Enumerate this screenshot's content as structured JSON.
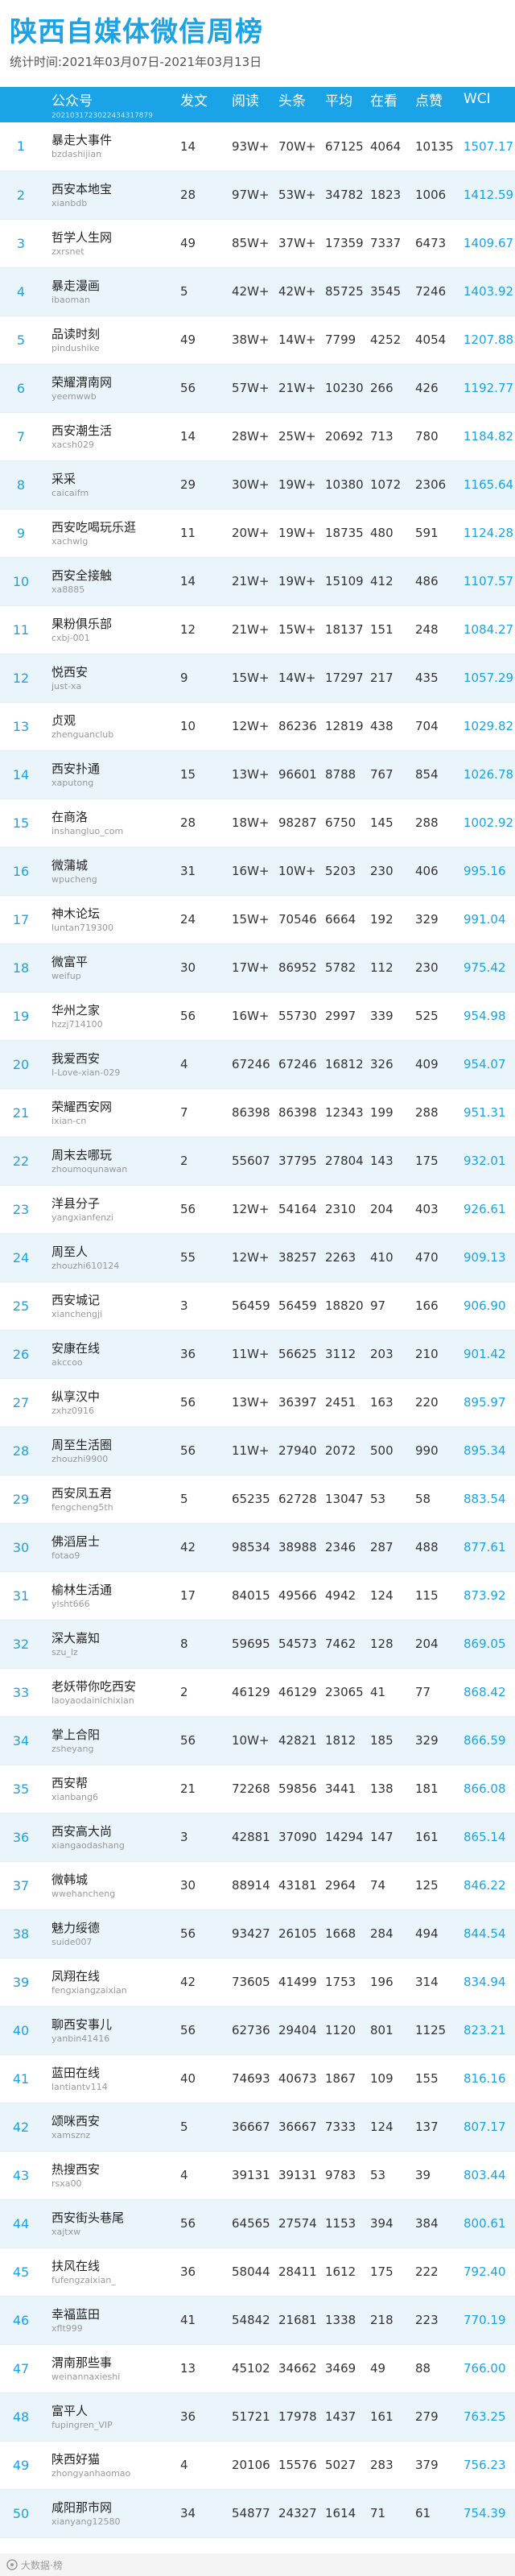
{
  "header": {
    "title": "陕西自媒体微信周榜",
    "period": "统计时间:2021年03月07日-2021年03月13日"
  },
  "columns": {
    "account": "公众号",
    "posts": "发文",
    "reads": "阅读",
    "headline": "头条",
    "average": "平均",
    "watching": "在看",
    "likes": "点赞",
    "wci": "WCI",
    "sub_code": "20210317230224343178​79"
  },
  "rows": [
    {
      "rank": "1",
      "name": "暴走大事件",
      "id": "bzdashijian",
      "posts": "14",
      "reads": "93W+",
      "head": "70W+",
      "avg": "67125",
      "see": "4064",
      "like": "10135",
      "wci": "1507.17"
    },
    {
      "rank": "2",
      "name": "西安本地宝",
      "id": "xianbdb",
      "posts": "28",
      "reads": "97W+",
      "head": "53W+",
      "avg": "34782",
      "see": "1823",
      "like": "1006",
      "wci": "1412.59"
    },
    {
      "rank": "3",
      "name": "哲学人生网",
      "id": "zxrsnet",
      "posts": "49",
      "reads": "85W+",
      "head": "37W+",
      "avg": "17359",
      "see": "7337",
      "like": "6473",
      "wci": "1409.67"
    },
    {
      "rank": "4",
      "name": "暴走漫画",
      "id": "ibaoman",
      "posts": "5",
      "reads": "42W+",
      "head": "42W+",
      "avg": "85725",
      "see": "3545",
      "like": "7246",
      "wci": "1403.92"
    },
    {
      "rank": "5",
      "name": "品读时刻",
      "id": "pindushike",
      "posts": "49",
      "reads": "38W+",
      "head": "14W+",
      "avg": "7799",
      "see": "4252",
      "like": "4054",
      "wci": "1207.88"
    },
    {
      "rank": "6",
      "name": "荣耀渭南网",
      "id": "yeemwwb",
      "posts": "56",
      "reads": "57W+",
      "head": "21W+",
      "avg": "10230",
      "see": "266",
      "like": "426",
      "wci": "1192.77"
    },
    {
      "rank": "7",
      "name": "西安潮生活",
      "id": "xacsh029",
      "posts": "14",
      "reads": "28W+",
      "head": "25W+",
      "avg": "20692",
      "see": "713",
      "like": "780",
      "wci": "1184.82"
    },
    {
      "rank": "8",
      "name": "采采",
      "id": "caicaifm",
      "posts": "29",
      "reads": "30W+",
      "head": "19W+",
      "avg": "10380",
      "see": "1072",
      "like": "2306",
      "wci": "1165.64"
    },
    {
      "rank": "9",
      "name": "西安吃喝玩乐逛",
      "id": "xachwlg",
      "posts": "11",
      "reads": "20W+",
      "head": "19W+",
      "avg": "18735",
      "see": "480",
      "like": "591",
      "wci": "1124.28"
    },
    {
      "rank": "10",
      "name": "西安全接触",
      "id": "xa8885",
      "posts": "14",
      "reads": "21W+",
      "head": "19W+",
      "avg": "15109",
      "see": "412",
      "like": "486",
      "wci": "1107.57"
    },
    {
      "rank": "11",
      "name": "果粉俱乐部",
      "id": "cxbj-001",
      "posts": "12",
      "reads": "21W+",
      "head": "15W+",
      "avg": "18137",
      "see": "151",
      "like": "248",
      "wci": "1084.27"
    },
    {
      "rank": "12",
      "name": "悦西安",
      "id": "just-xa",
      "posts": "9",
      "reads": "15W+",
      "head": "14W+",
      "avg": "17297",
      "see": "217",
      "like": "435",
      "wci": "1057.29"
    },
    {
      "rank": "13",
      "name": "贞观",
      "id": "zhenguanclub",
      "posts": "10",
      "reads": "12W+",
      "head": "86236",
      "avg": "12819",
      "see": "438",
      "like": "704",
      "wci": "1029.82"
    },
    {
      "rank": "14",
      "name": "西安扑通",
      "id": "xaputong",
      "posts": "15",
      "reads": "13W+",
      "head": "96601",
      "avg": "8788",
      "see": "767",
      "like": "854",
      "wci": "1026.78"
    },
    {
      "rank": "15",
      "name": "在商洛",
      "id": "inshangluo_com",
      "posts": "28",
      "reads": "18W+",
      "head": "98287",
      "avg": "6750",
      "see": "145",
      "like": "288",
      "wci": "1002.92"
    },
    {
      "rank": "16",
      "name": "微蒲城",
      "id": "wpucheng",
      "posts": "31",
      "reads": "16W+",
      "head": "10W+",
      "avg": "5203",
      "see": "230",
      "like": "406",
      "wci": "995.16"
    },
    {
      "rank": "17",
      "name": "神木论坛",
      "id": "luntan719300",
      "posts": "24",
      "reads": "15W+",
      "head": "70546",
      "avg": "6664",
      "see": "192",
      "like": "329",
      "wci": "991.04"
    },
    {
      "rank": "18",
      "name": "微富平",
      "id": "weifup",
      "posts": "30",
      "reads": "17W+",
      "head": "86952",
      "avg": "5782",
      "see": "112",
      "like": "230",
      "wci": "975.42"
    },
    {
      "rank": "19",
      "name": "华州之家",
      "id": "hzzj714100",
      "posts": "56",
      "reads": "16W+",
      "head": "55730",
      "avg": "2997",
      "see": "339",
      "like": "525",
      "wci": "954.98"
    },
    {
      "rank": "20",
      "name": "我爱西安",
      "id": "I-Love-xian-029",
      "posts": "4",
      "reads": "67246",
      "head": "67246",
      "avg": "16812",
      "see": "326",
      "like": "409",
      "wci": "954.07"
    },
    {
      "rank": "21",
      "name": "荣耀西安网",
      "id": "ixian-cn",
      "posts": "7",
      "reads": "86398",
      "head": "86398",
      "avg": "12343",
      "see": "199",
      "like": "288",
      "wci": "951.31"
    },
    {
      "rank": "22",
      "name": "周末去哪玩",
      "id": "zhoumoqunawan",
      "posts": "2",
      "reads": "55607",
      "head": "37795",
      "avg": "27804",
      "see": "143",
      "like": "175",
      "wci": "932.01"
    },
    {
      "rank": "23",
      "name": "洋县分子",
      "id": "yangxianfenzi",
      "posts": "56",
      "reads": "12W+",
      "head": "54164",
      "avg": "2310",
      "see": "204",
      "like": "403",
      "wci": "926.61"
    },
    {
      "rank": "24",
      "name": "周至人",
      "id": "zhouzhi610124",
      "posts": "55",
      "reads": "12W+",
      "head": "38257",
      "avg": "2263",
      "see": "410",
      "like": "470",
      "wci": "909.13"
    },
    {
      "rank": "25",
      "name": "西安城记",
      "id": "xianchengji",
      "posts": "3",
      "reads": "56459",
      "head": "56459",
      "avg": "18820",
      "see": "97",
      "like": "166",
      "wci": "906.90"
    },
    {
      "rank": "26",
      "name": "安康在线",
      "id": "akccoo",
      "posts": "36",
      "reads": "11W+",
      "head": "56625",
      "avg": "3112",
      "see": "203",
      "like": "210",
      "wci": "901.42"
    },
    {
      "rank": "27",
      "name": "纵享汉中",
      "id": "zxhz0916",
      "posts": "56",
      "reads": "13W+",
      "head": "36397",
      "avg": "2451",
      "see": "163",
      "like": "220",
      "wci": "895.97"
    },
    {
      "rank": "28",
      "name": "周至生活圈",
      "id": "zhouzhi9900",
      "posts": "56",
      "reads": "11W+",
      "head": "27940",
      "avg": "2072",
      "see": "500",
      "like": "990",
      "wci": "895.34"
    },
    {
      "rank": "29",
      "name": "西安凤五君",
      "id": "fengcheng5th",
      "posts": "5",
      "reads": "65235",
      "head": "62728",
      "avg": "13047",
      "see": "53",
      "like": "58",
      "wci": "883.54"
    },
    {
      "rank": "30",
      "name": "佛滔居士",
      "id": "fotao9",
      "posts": "42",
      "reads": "98534",
      "head": "38988",
      "avg": "2346",
      "see": "287",
      "like": "488",
      "wci": "877.61"
    },
    {
      "rank": "31",
      "name": "榆林生活通",
      "id": "ylsht666",
      "posts": "17",
      "reads": "84015",
      "head": "49566",
      "avg": "4942",
      "see": "124",
      "like": "115",
      "wci": "873.92"
    },
    {
      "rank": "32",
      "name": "深大嘉知",
      "id": "szu_lz",
      "posts": "8",
      "reads": "59695",
      "head": "54573",
      "avg": "7462",
      "see": "128",
      "like": "204",
      "wci": "869.05"
    },
    {
      "rank": "33",
      "name": "老妖带你吃西安",
      "id": "laoyaodainichixian",
      "posts": "2",
      "reads": "46129",
      "head": "46129",
      "avg": "23065",
      "see": "41",
      "like": "77",
      "wci": "868.42"
    },
    {
      "rank": "34",
      "name": "掌上合阳",
      "id": "zsheyang",
      "posts": "56",
      "reads": "10W+",
      "head": "42821",
      "avg": "1812",
      "see": "185",
      "like": "329",
      "wci": "866.59"
    },
    {
      "rank": "35",
      "name": "西安帮",
      "id": "xianbang6",
      "posts": "21",
      "reads": "72268",
      "head": "59856",
      "avg": "3441",
      "see": "138",
      "like": "181",
      "wci": "866.08"
    },
    {
      "rank": "36",
      "name": "西安高大尚",
      "id": "xiangaodashang",
      "posts": "3",
      "reads": "42881",
      "head": "37090",
      "avg": "14294",
      "see": "147",
      "like": "161",
      "wci": "865.14"
    },
    {
      "rank": "37",
      "name": "微韩城",
      "id": "wwehancheng",
      "posts": "30",
      "reads": "88914",
      "head": "43181",
      "avg": "2964",
      "see": "74",
      "like": "125",
      "wci": "846.22"
    },
    {
      "rank": "38",
      "name": "魅力绥德",
      "id": "suide007",
      "posts": "56",
      "reads": "93427",
      "head": "26105",
      "avg": "1668",
      "see": "284",
      "like": "494",
      "wci": "844.54"
    },
    {
      "rank": "39",
      "name": "凤翔在线",
      "id": "fengxiangzaixian",
      "posts": "42",
      "reads": "73605",
      "head": "41499",
      "avg": "1753",
      "see": "196",
      "like": "314",
      "wci": "834.94"
    },
    {
      "rank": "40",
      "name": "聊西安事儿",
      "id": "yanbin41416",
      "posts": "56",
      "reads": "62736",
      "head": "29404",
      "avg": "1120",
      "see": "801",
      "like": "1125",
      "wci": "823.21"
    },
    {
      "rank": "41",
      "name": "蓝田在线",
      "id": "lantiantv114",
      "posts": "40",
      "reads": "74693",
      "head": "40673",
      "avg": "1867",
      "see": "109",
      "like": "155",
      "wci": "816.16"
    },
    {
      "rank": "42",
      "name": "颂咪西安",
      "id": "xamsznz",
      "posts": "5",
      "reads": "36667",
      "head": "36667",
      "avg": "7333",
      "see": "124",
      "like": "137",
      "wci": "807.17"
    },
    {
      "rank": "43",
      "name": "热搜西安",
      "id": "rsxa00",
      "posts": "4",
      "reads": "39131",
      "head": "39131",
      "avg": "9783",
      "see": "53",
      "like": "39",
      "wci": "803.44"
    },
    {
      "rank": "44",
      "name": "西安街头巷尾",
      "id": "xajtxw",
      "posts": "56",
      "reads": "64565",
      "head": "27574",
      "avg": "1153",
      "see": "394",
      "like": "384",
      "wci": "800.61"
    },
    {
      "rank": "45",
      "name": "扶风在线",
      "id": "fufengzaixian_",
      "posts": "36",
      "reads": "58044",
      "head": "28411",
      "avg": "1612",
      "see": "175",
      "like": "222",
      "wci": "792.40"
    },
    {
      "rank": "46",
      "name": "幸福蓝田",
      "id": "xflt999",
      "posts": "41",
      "reads": "54842",
      "head": "21681",
      "avg": "1338",
      "see": "218",
      "like": "223",
      "wci": "770.19"
    },
    {
      "rank": "47",
      "name": "渭南那些事",
      "id": "weinannaxieshi",
      "posts": "13",
      "reads": "45102",
      "head": "34662",
      "avg": "3469",
      "see": "49",
      "like": "88",
      "wci": "766.00"
    },
    {
      "rank": "48",
      "name": "富平人",
      "id": "fupingren_VIP",
      "posts": "36",
      "reads": "51721",
      "head": "17978",
      "avg": "1437",
      "see": "161",
      "like": "279",
      "wci": "763.25"
    },
    {
      "rank": "49",
      "name": "陕西好猫",
      "id": "zhongyanhaomao",
      "posts": "4",
      "reads": "20106",
      "head": "15576",
      "avg": "5027",
      "see": "283",
      "like": "379",
      "wci": "756.23"
    },
    {
      "rank": "50",
      "name": "咸阳那市网",
      "id": "xianyang12580",
      "posts": "34",
      "reads": "54877",
      "head": "24327",
      "avg": "1614",
      "see": "71",
      "like": "61",
      "wci": "754.39"
    }
  ],
  "footer": {
    "source": "大数据·榜"
  },
  "colors": {
    "accent": "#1aa3e6",
    "stripe": "#eaf4fb"
  }
}
